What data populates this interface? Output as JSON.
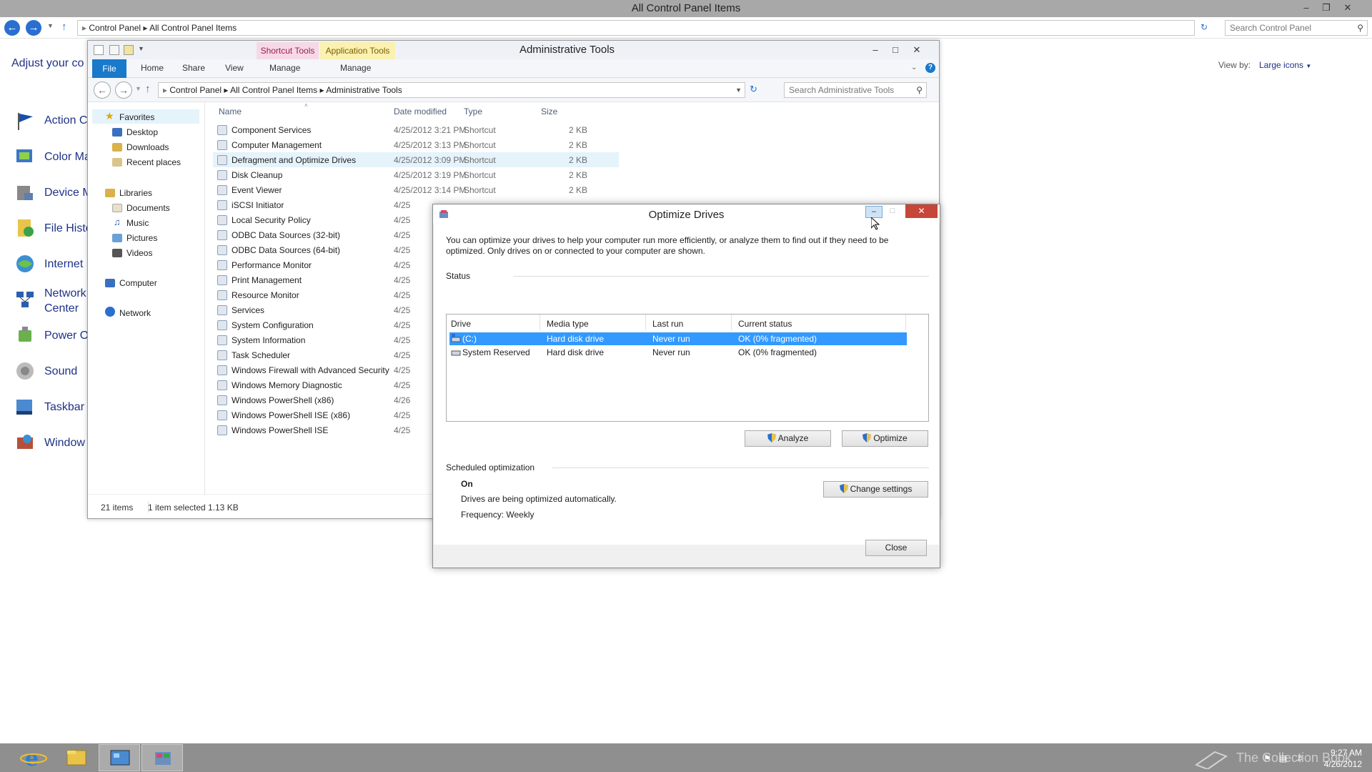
{
  "control_panel": {
    "title": "All Control Panel Items",
    "breadcrumb": [
      "Control Panel",
      "All Control Panel Items"
    ],
    "search_placeholder": "Search Control Panel",
    "heading": "Adjust your co",
    "view_by_label": "View by:",
    "view_by_value": "Large icons",
    "items": [
      "Action C",
      "Color Ma",
      "Device M",
      "File Histo",
      "Internet",
      "Network",
      "Center",
      "Power O",
      "Sound",
      "Taskbar",
      "Window"
    ]
  },
  "explorer": {
    "title": "Administrative Tools",
    "context_tabs": [
      "Shortcut Tools",
      "Application Tools"
    ],
    "ribbon_tabs": [
      "File",
      "Home",
      "Share",
      "View",
      "Manage",
      "Manage"
    ],
    "breadcrumb": [
      "Control Panel",
      "All Control Panel Items",
      "Administrative Tools"
    ],
    "search_placeholder": "Search Administrative Tools",
    "nav": {
      "favorites": "Favorites",
      "favorites_items": [
        "Desktop",
        "Downloads",
        "Recent places"
      ],
      "libraries": "Libraries",
      "libraries_items": [
        "Documents",
        "Music",
        "Pictures",
        "Videos"
      ],
      "computer": "Computer",
      "network": "Network"
    },
    "columns": [
      "Name",
      "Date modified",
      "Type",
      "Size"
    ],
    "files": [
      {
        "name": "Component Services",
        "date": "4/25/2012 3:21 PM",
        "type": "Shortcut",
        "size": "2 KB"
      },
      {
        "name": "Computer Management",
        "date": "4/25/2012 3:13 PM",
        "type": "Shortcut",
        "size": "2 KB"
      },
      {
        "name": "Defragment and Optimize Drives",
        "date": "4/25/2012 3:09 PM",
        "type": "Shortcut",
        "size": "2 KB"
      },
      {
        "name": "Disk Cleanup",
        "date": "4/25/2012 3:19 PM",
        "type": "Shortcut",
        "size": "2 KB"
      },
      {
        "name": "Event Viewer",
        "date": "4/25/2012 3:14 PM",
        "type": "Shortcut",
        "size": "2 KB"
      },
      {
        "name": "iSCSI Initiator",
        "date": "4/25",
        "type": "",
        "size": ""
      },
      {
        "name": "Local Security Policy",
        "date": "4/25",
        "type": "",
        "size": ""
      },
      {
        "name": "ODBC Data Sources (32-bit)",
        "date": "4/25",
        "type": "",
        "size": ""
      },
      {
        "name": "ODBC Data Sources (64-bit)",
        "date": "4/25",
        "type": "",
        "size": ""
      },
      {
        "name": "Performance Monitor",
        "date": "4/25",
        "type": "",
        "size": ""
      },
      {
        "name": "Print Management",
        "date": "4/25",
        "type": "",
        "size": ""
      },
      {
        "name": "Resource Monitor",
        "date": "4/25",
        "type": "",
        "size": ""
      },
      {
        "name": "Services",
        "date": "4/25",
        "type": "",
        "size": ""
      },
      {
        "name": "System Configuration",
        "date": "4/25",
        "type": "",
        "size": ""
      },
      {
        "name": "System Information",
        "date": "4/25",
        "type": "",
        "size": ""
      },
      {
        "name": "Task Scheduler",
        "date": "4/25",
        "type": "",
        "size": ""
      },
      {
        "name": "Windows Firewall with Advanced Security",
        "date": "4/25",
        "type": "",
        "size": ""
      },
      {
        "name": "Windows Memory Diagnostic",
        "date": "4/25",
        "type": "",
        "size": ""
      },
      {
        "name": "Windows PowerShell (x86)",
        "date": "4/26",
        "type": "",
        "size": ""
      },
      {
        "name": "Windows PowerShell ISE (x86)",
        "date": "4/25",
        "type": "",
        "size": ""
      },
      {
        "name": "Windows PowerShell ISE",
        "date": "4/25",
        "type": "",
        "size": ""
      }
    ],
    "status": {
      "count": "21 items",
      "selected": "1 item selected",
      "size": "1.13 KB"
    }
  },
  "optimize": {
    "title": "Optimize Drives",
    "description": "You can optimize your drives to help your computer run more efficiently, or analyze them to find out if they need to be optimized. Only drives on or connected to your computer are shown.",
    "status_label": "Status",
    "columns": [
      "Drive",
      "Media type",
      "Last run",
      "Current status"
    ],
    "drives": [
      {
        "drive": "(C:)",
        "media": "Hard disk drive",
        "last_run": "Never run",
        "status": "OK (0% fragmented)"
      },
      {
        "drive": "System Reserved",
        "media": "Hard disk drive",
        "last_run": "Never run",
        "status": "OK (0% fragmented)"
      }
    ],
    "analyze_label": "Analyze",
    "optimize_label": "Optimize",
    "scheduled_label": "Scheduled optimization",
    "schedule_state": "On",
    "schedule_desc": "Drives are being optimized automatically.",
    "frequency": "Frequency: Weekly",
    "change_settings_label": "Change settings",
    "close_label": "Close"
  },
  "taskbar": {
    "time": "9:27 AM",
    "date": "4/26/2012",
    "watermark": "The Collection Book"
  },
  "colors": {
    "selection": "#3399ff",
    "link": "#1e3287",
    "shortcut_tools": "#f7d9e6",
    "application_tools": "#fbf1b0"
  }
}
